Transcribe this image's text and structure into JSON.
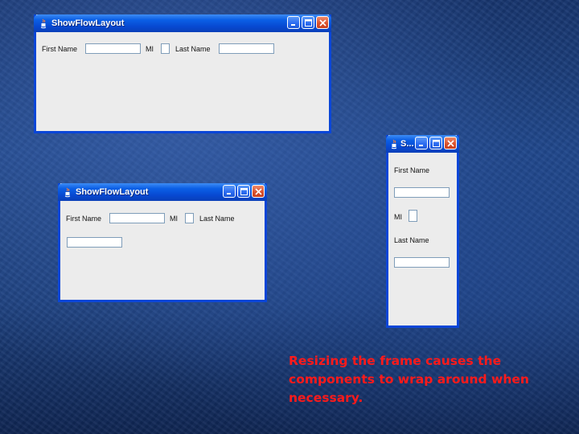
{
  "windows": [
    {
      "title": "ShowFlowLayout",
      "labels": {
        "first": "First Name",
        "mi": "MI",
        "last": "Last Name"
      }
    },
    {
      "title": "ShowFlowLayout",
      "labels": {
        "first": "First Name",
        "mi": "MI",
        "last": "Last Name"
      }
    },
    {
      "title": "S...",
      "labels": {
        "first": "First Name",
        "mi": "MI",
        "last": "Last Name"
      }
    }
  ],
  "fields": {
    "first_name": "",
    "mi": "",
    "last_name": ""
  },
  "caption": "Resizing the frame causes the components to wrap around when necessary.",
  "colors": {
    "caption": "#ff1a1a",
    "titlebar": "#0748d0",
    "window_bg": "#ececec"
  },
  "icons": [
    "java-icon",
    "minimize-icon",
    "maximize-icon",
    "close-icon"
  ]
}
